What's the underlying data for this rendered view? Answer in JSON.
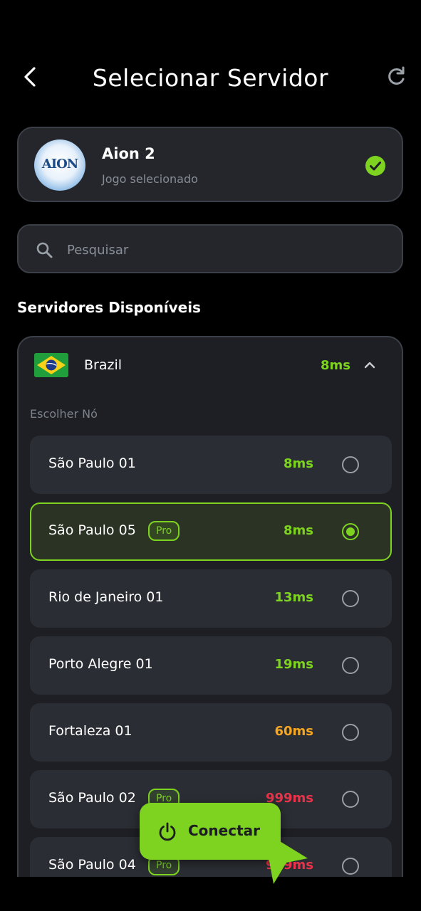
{
  "header": {
    "title": "Selecionar Servidor",
    "back_icon": "chevron-left-icon",
    "refresh_icon": "refresh-icon"
  },
  "game": {
    "name": "Aion 2",
    "subtitle": "Jogo selecionado",
    "logo_text": "AION",
    "selected_icon": "check-circle-icon"
  },
  "search": {
    "placeholder": "Pesquisar",
    "value": ""
  },
  "section_title": "Servidores Disponíveis",
  "region": {
    "name": "Brazil",
    "ping": "8ms",
    "expanded": true,
    "node_label": "Escolher Nó",
    "nodes": [
      {
        "name": "São Paulo 01",
        "pro": false,
        "ping": "8ms",
        "ping_color": "#7ed321",
        "selected": false
      },
      {
        "name": "São Paulo 05",
        "pro": true,
        "pro_label": "Pro",
        "ping": "8ms",
        "ping_color": "#7ed321",
        "selected": true
      },
      {
        "name": "Rio de Janeiro 01",
        "pro": false,
        "ping": "13ms",
        "ping_color": "#7ed321",
        "selected": false
      },
      {
        "name": "Porto Alegre 01",
        "pro": false,
        "ping": "19ms",
        "ping_color": "#7ed321",
        "selected": false
      },
      {
        "name": "Fortaleza 01",
        "pro": false,
        "ping": "60ms",
        "ping_color": "#f5a623",
        "selected": false
      },
      {
        "name": "São Paulo 02",
        "pro": true,
        "pro_label": "Pro",
        "ping": "999ms",
        "ping_color": "#e8344a",
        "selected": false
      },
      {
        "name": "São Paulo 04",
        "pro": true,
        "pro_label": "Pro",
        "ping": "999ms",
        "ping_color": "#e8344a",
        "selected": false
      }
    ]
  },
  "connect": {
    "label": "Conectar",
    "icon": "power-icon"
  },
  "colors": {
    "accent": "#7ed321",
    "warning": "#f5a623",
    "danger": "#e8344a",
    "card_bg": "#24262c",
    "node_bg": "#2a2d33"
  }
}
